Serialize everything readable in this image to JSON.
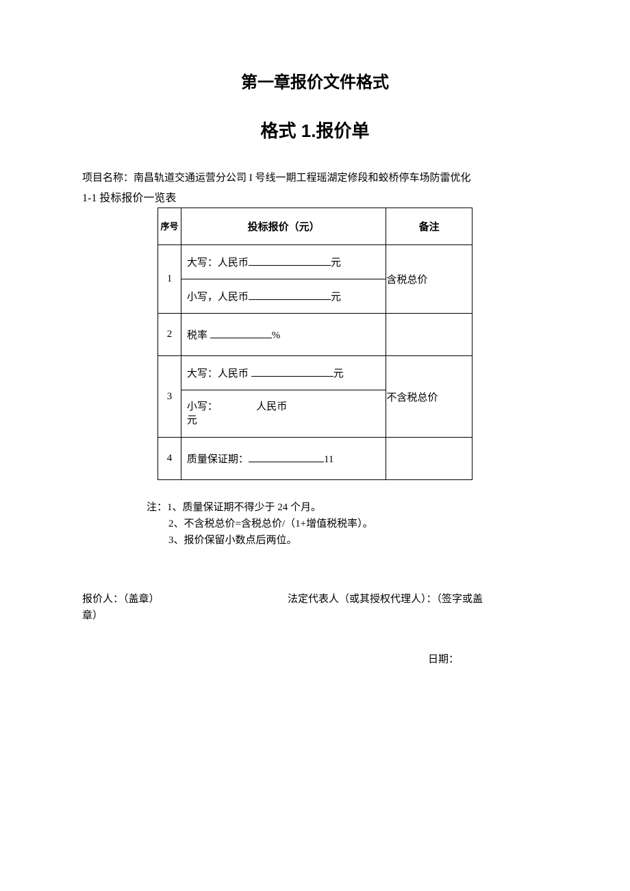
{
  "headings": {
    "chapter": "第一章报价文件格式",
    "format": "格式 1.报价单"
  },
  "project": {
    "label": "项目名称：",
    "name": "南昌轨道交通运营分公司 I 号线一期工程瑶湖定修段和蛟桥停车场防雷优化"
  },
  "table_title": "1-1  投标报价一览表",
  "headers": {
    "seq": "序号",
    "price": "投标报价（元）",
    "remark": "备注"
  },
  "rows": [
    {
      "seq": "1",
      "line1_prefix": "大写：人民币",
      "line1_suffix": "元",
      "line2_prefix": "小写，人民币",
      "line2_suffix": "元",
      "remark": "含税总价"
    },
    {
      "seq": "2",
      "line_prefix": "税率",
      "line_suffix": "%",
      "remark": ""
    },
    {
      "seq": "3",
      "line1_prefix": "大写：人民币",
      "line1_suffix": "元",
      "line2a": "小写：",
      "line2b": "人民币",
      "line2c": "元",
      "remark": "不含税总价"
    },
    {
      "seq": "4",
      "line_prefix": "质量保证期：",
      "line_suffix": "11",
      "remark": ""
    }
  ],
  "notes": {
    "n1": "注：1、质量保证期不得少于 24 个月。",
    "n2": "2、不含税总价=含税总价/（1+增值税税率）。",
    "n3": "3、报价保留小数点后两位。"
  },
  "signatures": {
    "bidder": "报价人：（盖章）",
    "rep": "法定代表人（或其授权代理人）：（签字或盖",
    "rep_cont": "章）",
    "date": "日期："
  }
}
